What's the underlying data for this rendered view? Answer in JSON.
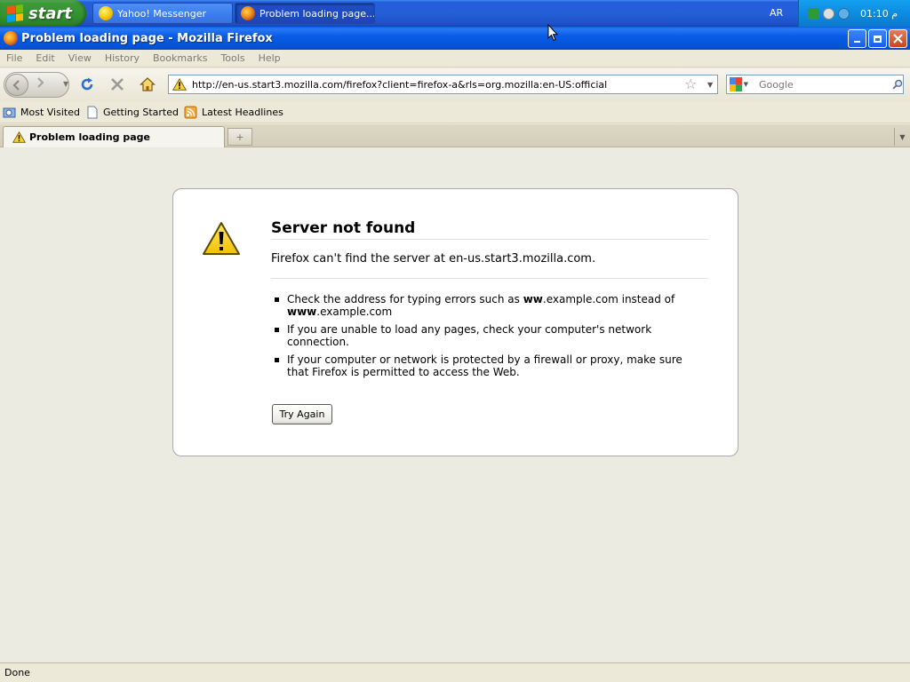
{
  "taskbar": {
    "start_label": "start",
    "tasks": [
      {
        "label": "Yahoo! Messenger",
        "icon": "yahoo-messenger-icon",
        "active": false
      },
      {
        "label": "Problem loading page...",
        "icon": "firefox-icon",
        "active": true
      }
    ],
    "language": "AR",
    "clock": "01:10 م"
  },
  "window": {
    "title": "Problem loading page - Mozilla Firefox"
  },
  "menu": {
    "items": [
      "File",
      "Edit",
      "View",
      "History",
      "Bookmarks",
      "Tools",
      "Help"
    ]
  },
  "navigation": {
    "url": "http://en-us.start3.mozilla.com/firefox?client=firefox-a&rls=org.mozilla:en-US:official",
    "search_placeholder": "Google"
  },
  "bookmarks": {
    "items": [
      "Most Visited",
      "Getting Started",
      "Latest Headlines"
    ]
  },
  "tabs": {
    "active_label": "Problem loading page",
    "new_tab_glyph": "+"
  },
  "error": {
    "title": "Server not found",
    "description": "Firefox can't find the server at en-us.start3.mozilla.com.",
    "tips": {
      "tip1_pre": "Check the address for typing errors such as ",
      "tip1_b1": "ww",
      "tip1_mid": ".example.com instead of ",
      "tip1_b2": "www",
      "tip1_post": ".example.com",
      "tip2": "If you are unable to load any pages, check your computer's network connection.",
      "tip3": "If your computer or network is protected by a firewall or proxy, make sure that Firefox is permitted to access the Web."
    },
    "button_label": "Try Again"
  },
  "status": {
    "text": "Done"
  },
  "colors": {
    "taskbar_blue": "#245edb",
    "start_green": "#3c9a38",
    "titlebar_blue": "#0a5ce6",
    "chrome_beige": "#ece9d8"
  }
}
